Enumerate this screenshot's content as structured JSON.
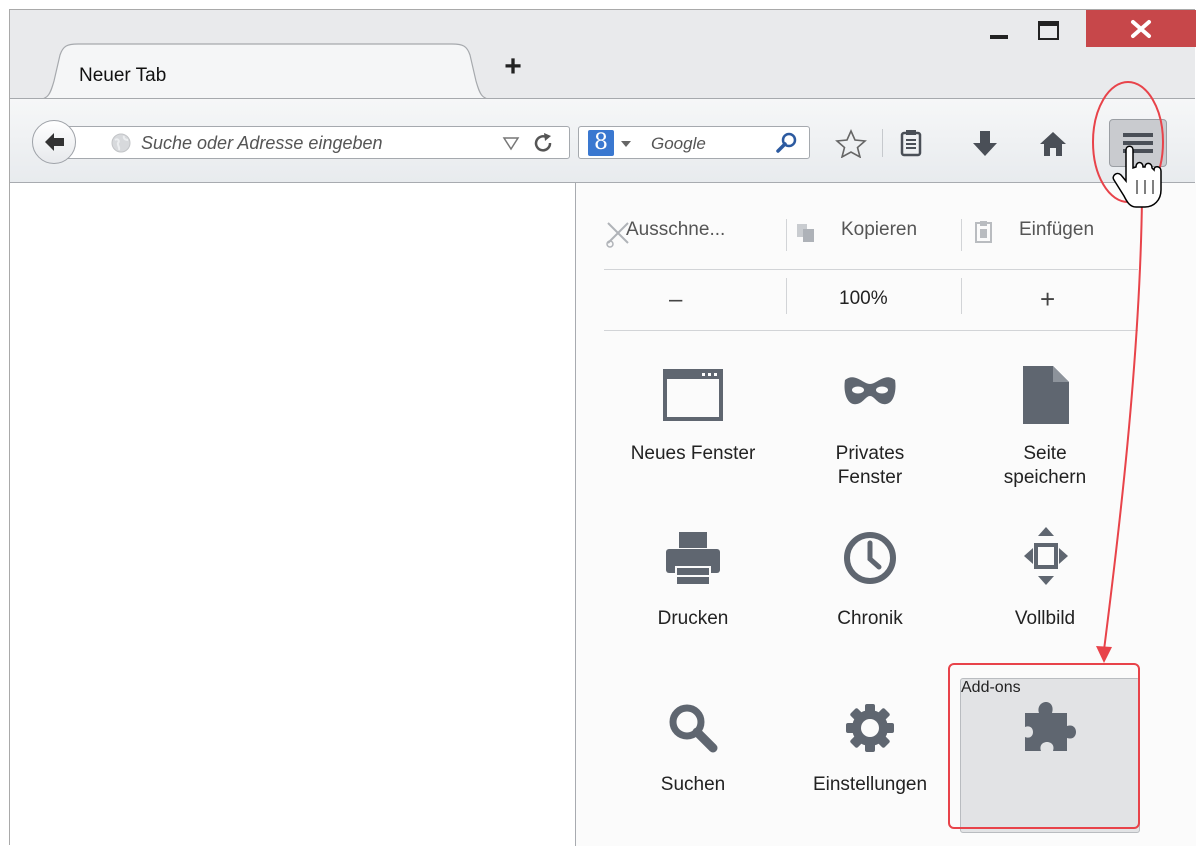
{
  "tab": {
    "title": "Neuer Tab",
    "new_tab_symbol": "+"
  },
  "navbar": {
    "url_placeholder": "Suche oder Adresse eingeben",
    "search_engine": "Google",
    "search_engine_icon_letter": "8"
  },
  "panel": {
    "edit": {
      "cut": "Ausschne...",
      "copy": "Kopieren",
      "paste": "Einfügen"
    },
    "zoom": {
      "minus": "–",
      "level": "100%",
      "plus": "+"
    },
    "items": [
      {
        "label": "Neues Fenster",
        "icon": "new-window-icon"
      },
      {
        "label_line1": "Privates",
        "label_line2": "Fenster",
        "icon": "private-mask-icon"
      },
      {
        "label_line1": "Seite",
        "label_line2": "speichern",
        "icon": "page-icon"
      },
      {
        "label": "Drucken",
        "icon": "printer-icon"
      },
      {
        "label": "Chronik",
        "icon": "clock-icon"
      },
      {
        "label": "Vollbild",
        "icon": "fullscreen-icon"
      },
      {
        "label": "Suchen",
        "icon": "magnifier-icon"
      },
      {
        "label": "Einstellungen",
        "icon": "gear-icon"
      },
      {
        "label": "Add-ons",
        "icon": "puzzle-icon"
      }
    ]
  },
  "colors": {
    "highlight_red": "#e8434a",
    "icon_gray": "#6b7380",
    "close_red": "#c7474a"
  }
}
